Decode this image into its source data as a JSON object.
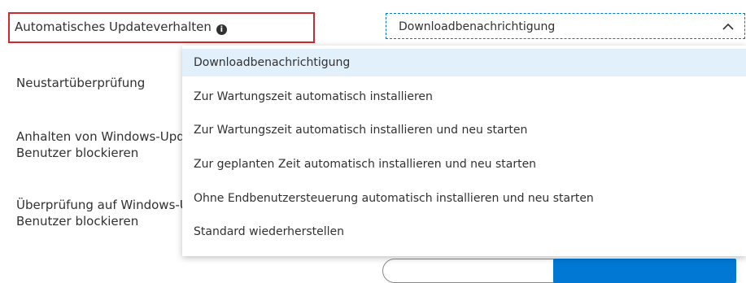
{
  "update_behavior": {
    "label": "Automatisches Updateverhalten",
    "info_icon_glyph": "i",
    "selected_value": "Downloadbenachrichtigung"
  },
  "settings_labels": {
    "restart_check": "Neustartüberprüfung",
    "pause_line1": "Anhalten von Windows-Updates",
    "pause_line2": "Benutzer blockieren",
    "check_line1": "Überprüfung auf Windows-Updates",
    "check_line2": "Benutzer blockieren"
  },
  "dropdown": {
    "options": [
      "Downloadbenachrichtigung",
      "Zur Wartungszeit automatisch installieren",
      "Zur Wartungszeit automatisch installieren und neu starten",
      "Zur geplanten Zeit automatisch installieren und neu starten",
      "Ohne Endbenutzersteuerung automatisch installieren und neu starten",
      "Standard wiederherstellen"
    ],
    "selected_index": 0
  },
  "colors": {
    "accent": "#0078d4",
    "highlight_border": "#d0282e",
    "selected_background": "#e1f0fb"
  }
}
